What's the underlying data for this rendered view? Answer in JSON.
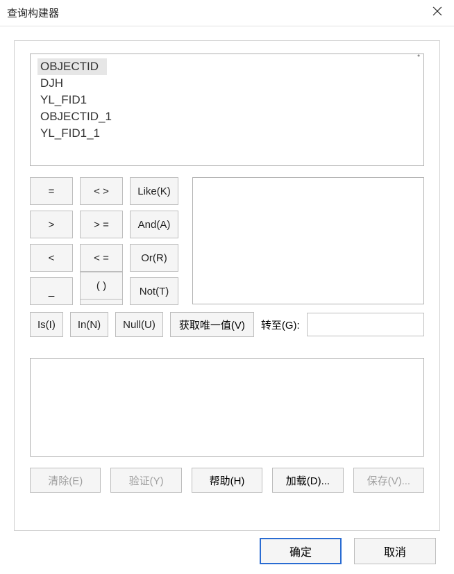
{
  "window": {
    "title": "查询构建器"
  },
  "fields": {
    "items": [
      "OBJECTID",
      "DJH",
      "YL_FID1",
      "OBJECTID_1",
      "YL_FID1_1"
    ],
    "selected_index": 0
  },
  "operators": {
    "row0": {
      "a": "=",
      "b": "< >",
      "c": "Like(K)"
    },
    "row1": {
      "a": ">",
      "b": "> =",
      "c": "And(A)"
    },
    "row2": {
      "a": "<",
      "b": "< =",
      "c": "Or(R)"
    },
    "row3": {
      "a": "_",
      "b": "%",
      "bb": "( )",
      "c": "Not(T)"
    }
  },
  "extra_ops": {
    "is": "Is(I)",
    "in": "In(N)",
    "null": "Null(U)",
    "get_unique": "获取唯一值(V)",
    "goto_label": "转至(G):",
    "goto_value": ""
  },
  "expression": {
    "value": ""
  },
  "bottom_buttons": {
    "clear": "清除(E)",
    "verify": "验证(Y)",
    "help": "帮助(H)",
    "load": "加载(D)...",
    "save": "保存(V)..."
  },
  "footer": {
    "ok": "确定",
    "cancel": "取消"
  }
}
